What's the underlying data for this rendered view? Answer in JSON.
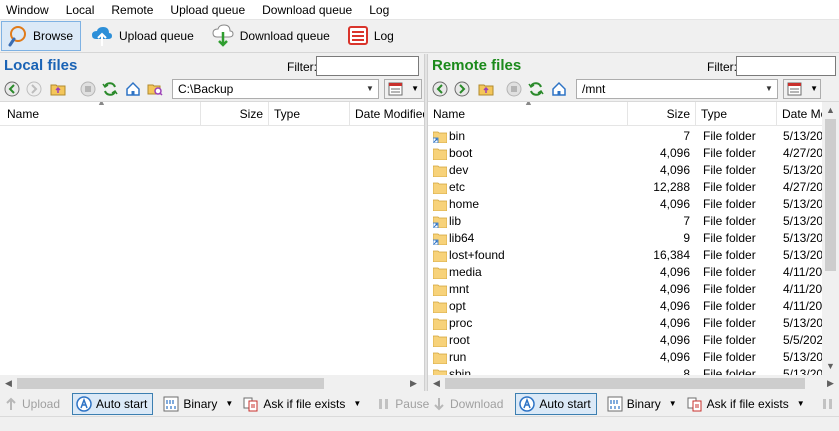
{
  "menu": [
    "Window",
    "Local",
    "Remote",
    "Upload queue",
    "Download queue",
    "Log"
  ],
  "toolbar": {
    "browse": "Browse",
    "upload_queue": "Upload queue",
    "download_queue": "Download queue",
    "log": "Log"
  },
  "local": {
    "title": "Local files",
    "filter_label": "Filter:",
    "filter_value": "",
    "path": "C:\\Backup",
    "columns": [
      "Name",
      "Size",
      "Type",
      "Date Modified"
    ]
  },
  "remote": {
    "title": "Remote files",
    "filter_label": "Filter:",
    "filter_value": "",
    "path": "/mnt",
    "columns": [
      "Name",
      "Size",
      "Type",
      "Date Modified"
    ],
    "rows": [
      {
        "name": "bin",
        "size": "7",
        "type": "File folder",
        "date": "5/13/20",
        "link": true
      },
      {
        "name": "boot",
        "size": "4,096",
        "type": "File folder",
        "date": "4/27/20",
        "link": false
      },
      {
        "name": "dev",
        "size": "4,096",
        "type": "File folder",
        "date": "5/13/20",
        "link": false
      },
      {
        "name": "etc",
        "size": "12,288",
        "type": "File folder",
        "date": "4/27/20",
        "link": false
      },
      {
        "name": "home",
        "size": "4,096",
        "type": "File folder",
        "date": "5/13/20",
        "link": false
      },
      {
        "name": "lib",
        "size": "7",
        "type": "File folder",
        "date": "5/13/20",
        "link": true
      },
      {
        "name": "lib64",
        "size": "9",
        "type": "File folder",
        "date": "5/13/20",
        "link": true
      },
      {
        "name": "lost+found",
        "size": "16,384",
        "type": "File folder",
        "date": "5/13/20",
        "link": false
      },
      {
        "name": "media",
        "size": "4,096",
        "type": "File folder",
        "date": "4/11/20",
        "link": false
      },
      {
        "name": "mnt",
        "size": "4,096",
        "type": "File folder",
        "date": "4/11/20",
        "link": false
      },
      {
        "name": "opt",
        "size": "4,096",
        "type": "File folder",
        "date": "4/11/20",
        "link": false
      },
      {
        "name": "proc",
        "size": "4,096",
        "type": "File folder",
        "date": "5/13/20",
        "link": false
      },
      {
        "name": "root",
        "size": "4,096",
        "type": "File folder",
        "date": "5/5/202",
        "link": false
      },
      {
        "name": "run",
        "size": "4,096",
        "type": "File folder",
        "date": "5/13/20",
        "link": false
      },
      {
        "name": "sbin",
        "size": "8",
        "type": "File folder",
        "date": "5/13/20",
        "link": true
      }
    ]
  },
  "bottom_left": {
    "upload": "Upload",
    "auto_start": "Auto start",
    "binary": "Binary",
    "ask_if_exists": "Ask if file exists",
    "pause": "Pause"
  },
  "bottom_right": {
    "download": "Download",
    "auto_start": "Auto start",
    "binary": "Binary",
    "ask_if_exists": "Ask if file exists"
  },
  "colors": {
    "local_title": "#1a63b5",
    "remote_title": "#1b8a1b",
    "selected_bg": "#dbe9f7"
  }
}
